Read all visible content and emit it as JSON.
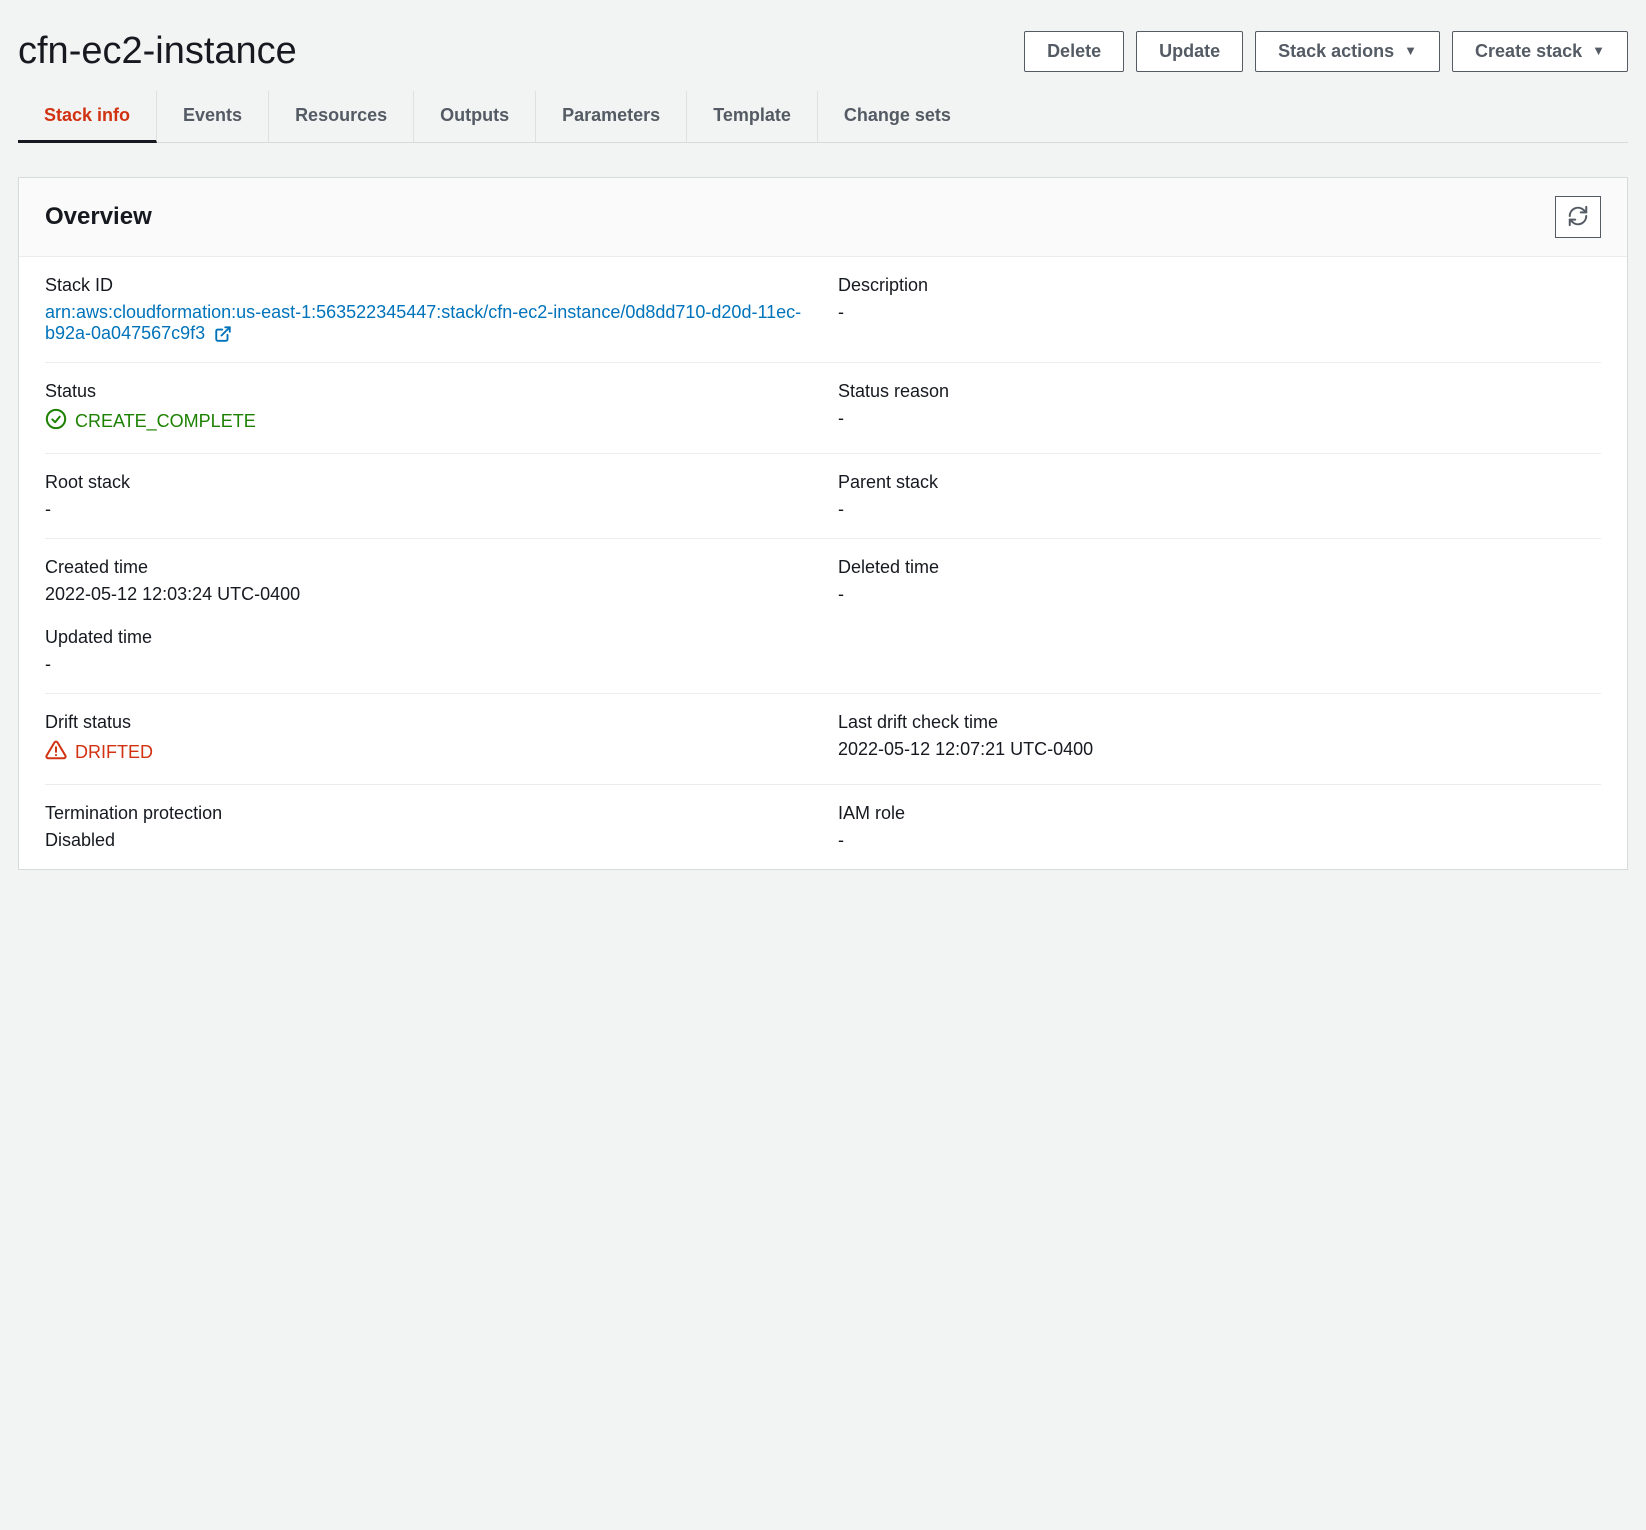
{
  "header": {
    "title": "cfn-ec2-instance",
    "buttons": {
      "delete": "Delete",
      "update": "Update",
      "stack_actions": "Stack actions",
      "create_stack": "Create stack"
    }
  },
  "tabs": {
    "stack_info": "Stack info",
    "events": "Events",
    "resources": "Resources",
    "outputs": "Outputs",
    "parameters": "Parameters",
    "template": "Template",
    "change_sets": "Change sets"
  },
  "overview": {
    "title": "Overview",
    "fields": {
      "stack_id_label": "Stack ID",
      "stack_id_value": "arn:aws:cloudformation:us-east-1:563522345447:stack/cfn-ec2-instance/0d8dd710-d20d-11ec-b92a-0a047567c9f3",
      "description_label": "Description",
      "description_value": "-",
      "status_label": "Status",
      "status_value": "CREATE_COMPLETE",
      "status_reason_label": "Status reason",
      "status_reason_value": "-",
      "root_stack_label": "Root stack",
      "root_stack_value": "-",
      "parent_stack_label": "Parent stack",
      "parent_stack_value": "-",
      "created_time_label": "Created time",
      "created_time_value": "2022-05-12 12:03:24 UTC-0400",
      "deleted_time_label": "Deleted time",
      "deleted_time_value": "-",
      "updated_time_label": "Updated time",
      "updated_time_value": "-",
      "drift_status_label": "Drift status",
      "drift_status_value": "DRIFTED",
      "last_drift_check_label": "Last drift check time",
      "last_drift_check_value": "2022-05-12 12:07:21 UTC-0400",
      "termination_protection_label": "Termination protection",
      "termination_protection_value": "Disabled",
      "iam_role_label": "IAM role",
      "iam_role_value": "-"
    }
  }
}
